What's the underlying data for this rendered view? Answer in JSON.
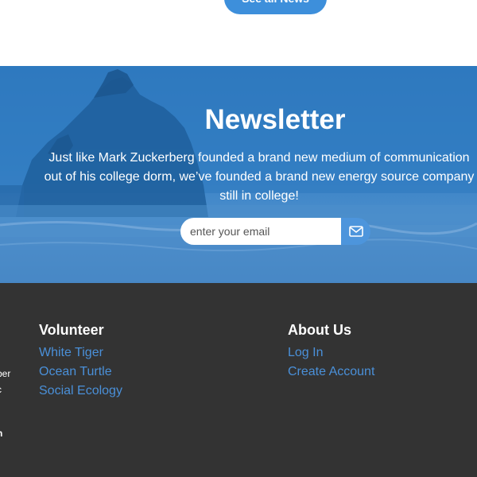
{
  "top": {
    "button_label": "See all News"
  },
  "newsletter": {
    "title": "Newsletter",
    "description_lines": [
      "Just like Mark Zuckerberg founded a brand new medium of communication",
      "out of his college dorm, we’ve founded a brand new energy source company",
      "still in college!"
    ],
    "email_placeholder": "enter your email",
    "submit_icon": "envelope-icon",
    "colors": {
      "overlay": "#2f78bd",
      "button": "#4d95dc"
    }
  },
  "footer": {
    "background": "#333333",
    "left_clipped_text": [
      "ber",
      "c",
      "-",
      "n"
    ],
    "columns": [
      {
        "title": "Volunteer",
        "links": [
          "White Tiger",
          "Ocean Turtle",
          "Social Ecology"
        ]
      },
      {
        "title": "About Us",
        "links": [
          "Log In",
          "Create Account"
        ]
      }
    ],
    "link_color": "#4a90d9"
  }
}
